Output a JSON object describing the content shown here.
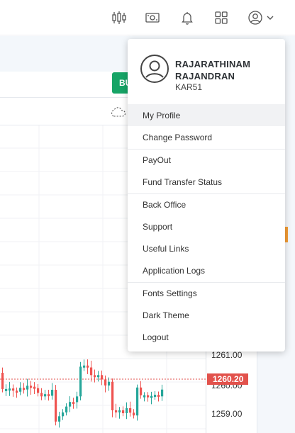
{
  "header": {
    "icons": [
      "candlestick-chart-icon",
      "cash-icon",
      "notification-bell-icon",
      "apps-grid-icon",
      "user-account-icon",
      "chevron-down-icon"
    ]
  },
  "toolbar": {
    "buy_label": "BU"
  },
  "chart": {
    "price_labels": [
      "1261.00",
      "1260.00",
      "1259.00"
    ],
    "current_price": "1260.20",
    "colors": {
      "up": "#26a69a",
      "down": "#ef5350"
    }
  },
  "profile": {
    "name_line1": "RAJARATHINAM",
    "name_line2": "RAJANDRAN",
    "code": "KAR51"
  },
  "menu": {
    "items": [
      "My Profile",
      "Change Password",
      "PayOut",
      "Fund Transfer Status",
      "Back Office",
      "Support",
      "Useful Links",
      "Application Logs",
      "Fonts Settings",
      "Dark Theme",
      "Logout"
    ]
  }
}
